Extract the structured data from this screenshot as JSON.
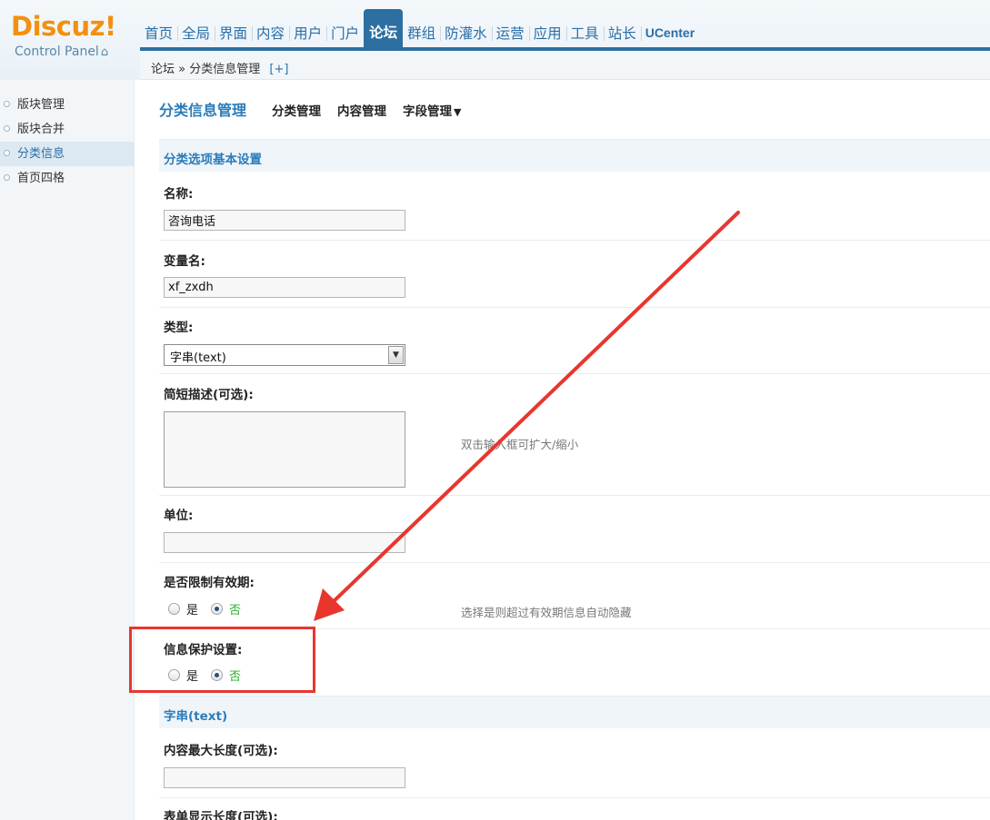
{
  "brand": {
    "logo": "Discuz!",
    "sub": "Control Panel",
    "home_icon": "home-icon"
  },
  "nav": [
    {
      "label": "首页",
      "active": false
    },
    {
      "label": "全局",
      "active": false
    },
    {
      "label": "界面",
      "active": false
    },
    {
      "label": "内容",
      "active": false
    },
    {
      "label": "用户",
      "active": false
    },
    {
      "label": "门户",
      "active": false
    },
    {
      "label": "论坛",
      "active": true
    },
    {
      "label": "群组",
      "active": false
    },
    {
      "label": "防灌水",
      "active": false
    },
    {
      "label": "运营",
      "active": false
    },
    {
      "label": "应用",
      "active": false
    },
    {
      "label": "工具",
      "active": false
    },
    {
      "label": "站长",
      "active": false
    },
    {
      "label": "UCenter",
      "active": false
    }
  ],
  "breadcrumb": {
    "root": "论坛",
    "sep": "»",
    "current": "分类信息管理",
    "add": "[+]"
  },
  "sidebar": {
    "items": [
      {
        "label": "版块管理",
        "active": false
      },
      {
        "label": "版块合并",
        "active": false
      },
      {
        "label": "分类信息",
        "active": true
      },
      {
        "label": "首页四格",
        "active": false
      }
    ]
  },
  "main": {
    "title": "分类信息管理",
    "links": {
      "category": "分类管理",
      "content": "内容管理",
      "fields": "字段管理",
      "fields_caret": "▼"
    },
    "section_basic": "分类选项基本设置",
    "name_label": "名称:",
    "name_value": "咨询电话",
    "var_label": "变量名:",
    "var_value": "xf_zxdh",
    "type_label": "类型:",
    "type_value": "字串(text)",
    "desc_label": "简短描述(可选):",
    "desc_hint": "双击输入框可扩大/缩小",
    "unit_label": "单位:",
    "unit_value": "",
    "expiry_label": "是否限制有效期:",
    "expiry_yes": "是",
    "expiry_no": "否",
    "expiry_hint": "选择是则超过有效期信息自动隐藏",
    "protect_label": "信息保护设置:",
    "protect_yes": "是",
    "protect_no": "否",
    "section_text": "字串(text)",
    "maxlen_label": "内容最大长度(可选):",
    "maxlen_value": "",
    "displen_label": "表单显示长度(可选):"
  },
  "annotation_color": "#e8362e"
}
